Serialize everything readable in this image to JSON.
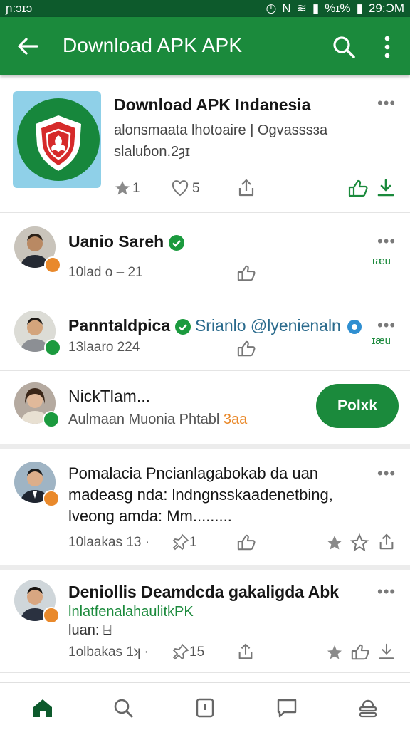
{
  "status_bar": {
    "time_left": "ɲ:ɔɪɔ",
    "battery": "%ɪ%",
    "time_right": "29:ƆM"
  },
  "app_bar": {
    "title": "Download APK APK"
  },
  "app_card": {
    "title": "Download APK Indanesia",
    "description": "alonsmaata lhotoaire | Ogvasssɜa",
    "version": "slaluɓon.2ȝɪ",
    "stars": "1",
    "likes": "5"
  },
  "posts": [
    {
      "name": "Uanio Sareh",
      "meta": "10lad o – 21",
      "side": "ɪæu"
    },
    {
      "name": "Panntaldpica",
      "handle": "Srianlo @lyenienaln",
      "meta": "13laaro 224",
      "side": "ɪæu"
    },
    {
      "name": "NickTlam...",
      "subtitle": "Aulmaan Muonia Phtabl",
      "subtitle_extra": "3aa",
      "action": "Polxk"
    },
    {
      "body": "Pomalacia Pncianlagabokab da uan madeasg nda: lndngnsskaadenetbing, lveong amda: Mm.........",
      "meta": "10laakas 13",
      "pin_count": "1"
    },
    {
      "name": "Deniollis Deamdcda gakaligda Abk",
      "link": "lnlatfenalahaulitkPK",
      "extra": "luan: ⍈",
      "meta": "1olbakas 1ʞ",
      "pin_count": "15"
    }
  ],
  "colors": {
    "brand_green": "#1b8a3c",
    "status_bar": "#0d5a2c",
    "accent_orange": "#e9892b"
  }
}
